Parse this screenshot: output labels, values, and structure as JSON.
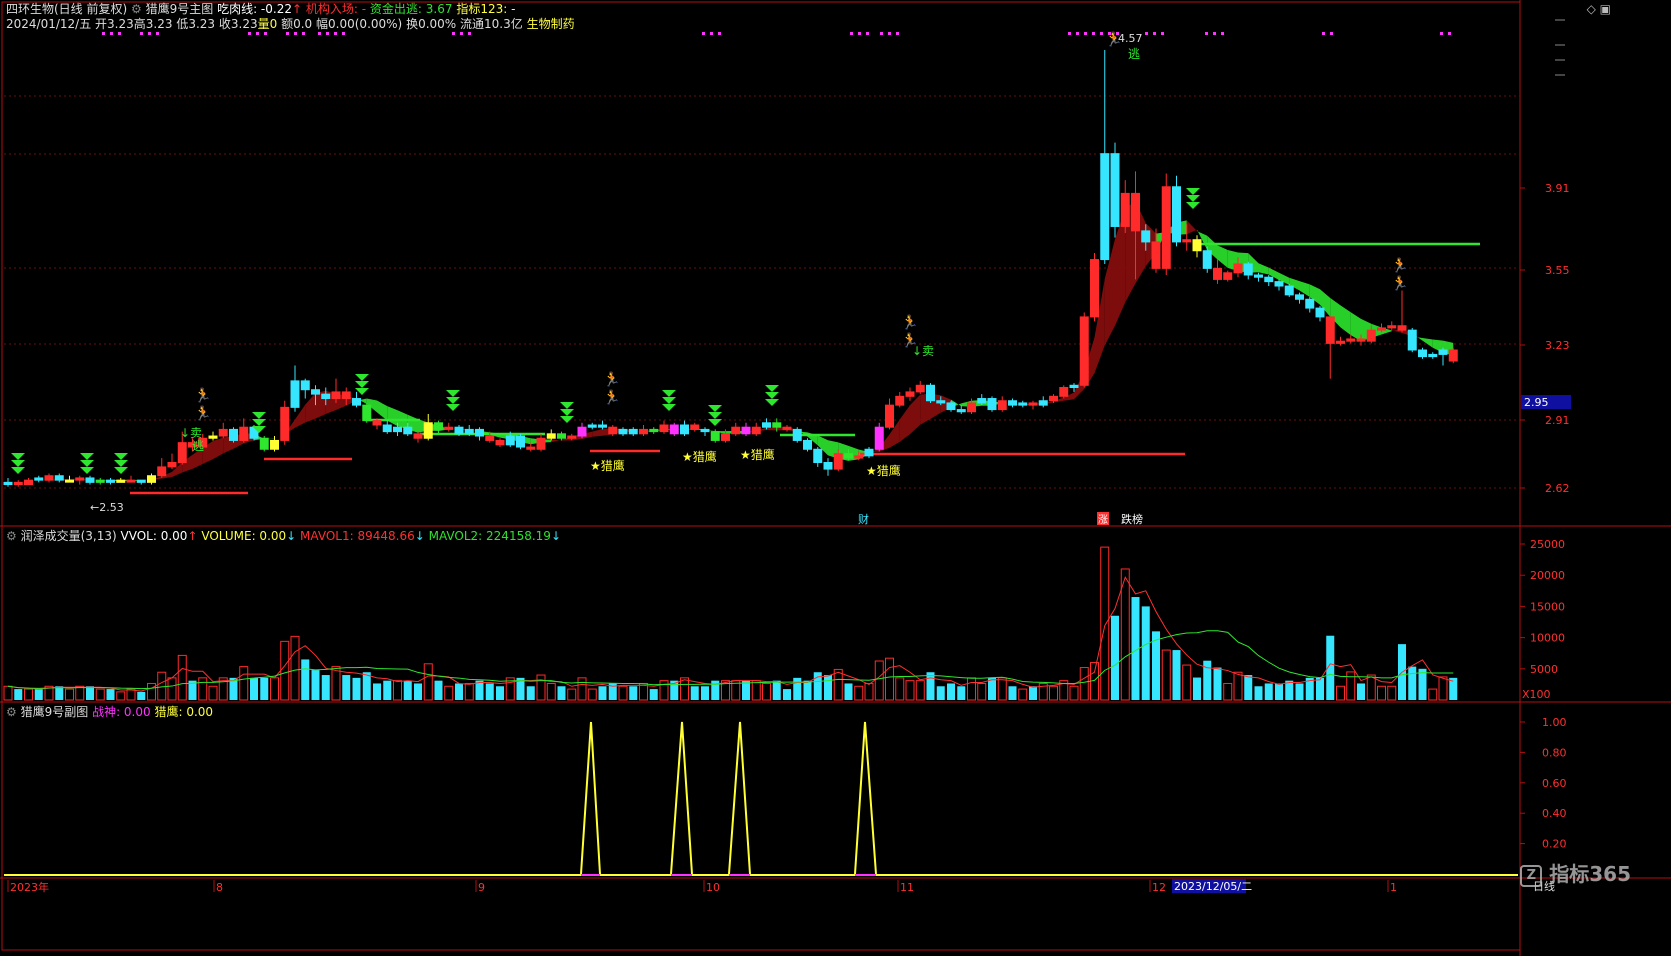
{
  "header": {
    "stock_name": "四环生物(日线 前复权)",
    "formula_name": "猎鹰9号主图",
    "eat_meat_label": "吃肉线: -0.22",
    "institution_label": "机构入场: -",
    "fund_out_label": "资金出逃: 3.67",
    "index_label": "指标123: -"
  },
  "quote": {
    "date": "2024/01/12/五",
    "open": "开3.23",
    "high": "高3.23",
    "low": "低3.23",
    "close": "收3.23",
    "vol": "量0",
    "amount": "额0.0",
    "change": "幅0.00(0.00%)",
    "turnover": "换0.00%",
    "float": "流通10.3亿",
    "sector": "生物制药"
  },
  "volume_panel": {
    "title": "润泽成交量(3,13)",
    "vvol": "VVOL: 0.00",
    "volume": "VOLUME: 0.00",
    "mavol1": "MAVOL1: 89448.66",
    "mavol2": "MAVOL2: 224158.19",
    "axis_labels": [
      "25000",
      "20000",
      "15000",
      "10000",
      "5000"
    ],
    "unit": "X100"
  },
  "sub_panel": {
    "title": "猎鹰9号副图",
    "zhanshen": "战神: 0.00",
    "lieying": "猎鹰: 0.00",
    "axis_labels": [
      "1.00",
      "0.80",
      "0.60",
      "0.40",
      "0.20"
    ]
  },
  "price_axis": {
    "labels": [
      "3.91",
      "3.55",
      "3.23",
      "2.91",
      "2.62"
    ],
    "current_price": "2.95"
  },
  "annotations": {
    "low_price": "2.53",
    "high_price": "4.57",
    "sell": "卖",
    "escape": "逃",
    "lieying_star": "★猎鹰",
    "cai": "财",
    "zhang": "涨",
    "dieban": "跌榜"
  },
  "time_axis": {
    "labels": [
      "2023年",
      "8",
      "9",
      "10",
      "11",
      "12",
      "1"
    ],
    "highlight": "2023/12/05/二",
    "period": "日线"
  },
  "watermark": "指标365",
  "colors": {
    "up": "#ff2a2a",
    "down": "#36e6ff",
    "ma_green": "#2ee62e",
    "ma_red": "#8b0d0d",
    "yellow": "#ffff33",
    "magenta": "#ff33ff"
  },
  "chart_data": {
    "type": "candlestick",
    "candles": [
      [
        2.6,
        2.61,
        2.63,
        2.59,
        "d"
      ],
      [
        2.61,
        2.6,
        2.62,
        2.59,
        "u"
      ],
      [
        2.6,
        2.62,
        2.63,
        2.6,
        "u"
      ],
      [
        2.63,
        2.62,
        2.64,
        2.61,
        "d"
      ],
      [
        2.62,
        2.64,
        2.65,
        2.61,
        "u"
      ],
      [
        2.64,
        2.62,
        2.65,
        2.61,
        "d"
      ],
      [
        2.62,
        2.62,
        2.64,
        2.61,
        "y"
      ],
      [
        2.62,
        2.63,
        2.64,
        2.6,
        "u"
      ],
      [
        2.63,
        2.61,
        2.64,
        2.6,
        "d"
      ],
      [
        2.61,
        2.62,
        2.63,
        2.6,
        "g"
      ],
      [
        2.62,
        2.61,
        2.63,
        2.6,
        "d"
      ],
      [
        2.61,
        2.62,
        2.63,
        2.61,
        "y"
      ],
      [
        2.62,
        2.62,
        2.64,
        2.61,
        "u"
      ],
      [
        2.62,
        2.61,
        2.62,
        2.6,
        "d"
      ],
      [
        2.61,
        2.64,
        2.65,
        2.6,
        "y"
      ],
      [
        2.64,
        2.68,
        2.72,
        2.63,
        "u"
      ],
      [
        2.68,
        2.7,
        2.74,
        2.67,
        "u"
      ],
      [
        2.7,
        2.79,
        2.84,
        2.69,
        "u"
      ],
      [
        2.79,
        2.77,
        2.81,
        2.75,
        "u"
      ],
      [
        2.77,
        2.81,
        2.83,
        2.76,
        "u"
      ],
      [
        2.81,
        2.82,
        2.84,
        2.8,
        "y"
      ],
      [
        2.82,
        2.85,
        2.88,
        2.81,
        "u"
      ],
      [
        2.85,
        2.8,
        2.86,
        2.79,
        "d"
      ],
      [
        2.8,
        2.86,
        2.9,
        2.79,
        "u"
      ],
      [
        2.86,
        2.81,
        2.87,
        2.8,
        "d"
      ],
      [
        2.81,
        2.76,
        2.82,
        2.75,
        "g"
      ],
      [
        2.76,
        2.8,
        2.82,
        2.75,
        "y"
      ],
      [
        2.8,
        2.95,
        2.98,
        2.78,
        "u"
      ],
      [
        2.95,
        3.07,
        3.14,
        2.93,
        "d"
      ],
      [
        3.07,
        3.03,
        3.08,
        2.99,
        "d"
      ],
      [
        3.03,
        3.01,
        3.05,
        2.96,
        "d"
      ],
      [
        3.01,
        2.99,
        3.04,
        2.96,
        "d"
      ],
      [
        2.99,
        3.02,
        3.08,
        2.97,
        "u"
      ],
      [
        3.02,
        2.99,
        3.04,
        2.96,
        "u"
      ],
      [
        2.99,
        2.96,
        3.02,
        2.95,
        "d"
      ],
      [
        2.96,
        2.89,
        2.97,
        2.88,
        "g"
      ],
      [
        2.89,
        2.87,
        2.9,
        2.85,
        "u"
      ],
      [
        2.87,
        2.84,
        2.89,
        2.83,
        "d"
      ],
      [
        2.84,
        2.86,
        2.88,
        2.82,
        "d"
      ],
      [
        2.86,
        2.83,
        2.88,
        2.82,
        "d"
      ],
      [
        2.83,
        2.81,
        2.84,
        2.79,
        "u"
      ],
      [
        2.81,
        2.88,
        2.92,
        2.8,
        "y"
      ],
      [
        2.88,
        2.85,
        2.89,
        2.83,
        "g"
      ],
      [
        2.85,
        2.86,
        2.88,
        2.84,
        "u"
      ],
      [
        2.86,
        2.83,
        2.87,
        2.82,
        "d"
      ],
      [
        2.83,
        2.85,
        2.87,
        2.82,
        "d"
      ],
      [
        2.85,
        2.82,
        2.86,
        2.8,
        "d"
      ],
      [
        2.82,
        2.8,
        2.84,
        2.79,
        "u"
      ],
      [
        2.8,
        2.78,
        2.81,
        2.77,
        "u"
      ],
      [
        2.78,
        2.82,
        2.84,
        2.77,
        "d"
      ],
      [
        2.82,
        2.77,
        2.83,
        2.76,
        "d"
      ],
      [
        2.77,
        2.76,
        2.79,
        2.75,
        "u"
      ],
      [
        2.76,
        2.81,
        2.83,
        2.75,
        "u"
      ],
      [
        2.81,
        2.83,
        2.85,
        2.8,
        "y"
      ],
      [
        2.83,
        2.81,
        2.84,
        2.8,
        "g"
      ],
      [
        2.81,
        2.82,
        2.83,
        2.8,
        "u"
      ],
      [
        2.82,
        2.86,
        2.88,
        2.81,
        "m"
      ],
      [
        2.86,
        2.87,
        2.88,
        2.85,
        "d"
      ],
      [
        2.87,
        2.86,
        2.89,
        2.85,
        "d"
      ],
      [
        2.86,
        2.83,
        2.87,
        2.82,
        "u"
      ],
      [
        2.83,
        2.85,
        2.86,
        2.82,
        "d"
      ],
      [
        2.85,
        2.83,
        2.86,
        2.82,
        "d"
      ],
      [
        2.83,
        2.85,
        2.87,
        2.82,
        "u"
      ],
      [
        2.85,
        2.84,
        2.86,
        2.83,
        "g"
      ],
      [
        2.84,
        2.87,
        2.89,
        2.83,
        "u"
      ],
      [
        2.87,
        2.83,
        2.88,
        2.82,
        "m"
      ],
      [
        2.83,
        2.87,
        2.89,
        2.82,
        "d"
      ],
      [
        2.87,
        2.85,
        2.88,
        2.84,
        "u"
      ],
      [
        2.85,
        2.84,
        2.86,
        2.82,
        "d"
      ],
      [
        2.84,
        2.8,
        2.85,
        2.79,
        "g"
      ],
      [
        2.8,
        2.83,
        2.85,
        2.79,
        "u"
      ],
      [
        2.83,
        2.86,
        2.88,
        2.82,
        "u"
      ],
      [
        2.86,
        2.83,
        2.88,
        2.82,
        "m"
      ],
      [
        2.83,
        2.86,
        2.88,
        2.82,
        "u"
      ],
      [
        2.86,
        2.88,
        2.9,
        2.85,
        "d"
      ],
      [
        2.88,
        2.86,
        2.9,
        2.84,
        "g"
      ],
      [
        2.86,
        2.85,
        2.87,
        2.84,
        "u"
      ],
      [
        2.85,
        2.8,
        2.86,
        2.79,
        "d"
      ],
      [
        2.8,
        2.76,
        2.81,
        2.75,
        "d"
      ],
      [
        2.76,
        2.7,
        2.77,
        2.68,
        "d"
      ],
      [
        2.7,
        2.67,
        2.72,
        2.64,
        "d"
      ],
      [
        2.67,
        2.74,
        2.76,
        2.66,
        "u"
      ],
      [
        2.74,
        2.72,
        2.76,
        2.71,
        "g"
      ],
      [
        2.72,
        2.73,
        2.75,
        2.71,
        "u"
      ],
      [
        2.73,
        2.76,
        2.77,
        2.72,
        "d"
      ],
      [
        2.76,
        2.86,
        2.88,
        2.75,
        "m"
      ],
      [
        2.86,
        2.96,
        2.99,
        2.85,
        "u"
      ],
      [
        2.96,
        3.0,
        3.02,
        2.95,
        "u"
      ],
      [
        3.0,
        3.02,
        3.04,
        2.98,
        "u"
      ],
      [
        3.02,
        3.05,
        3.07,
        3.01,
        "u"
      ],
      [
        3.05,
        2.98,
        3.06,
        2.97,
        "d"
      ],
      [
        2.98,
        2.97,
        3.0,
        2.96,
        "d"
      ],
      [
        2.97,
        2.94,
        2.98,
        2.93,
        "d"
      ],
      [
        2.94,
        2.93,
        2.96,
        2.92,
        "d"
      ],
      [
        2.93,
        2.97,
        2.99,
        2.92,
        "u"
      ],
      [
        2.97,
        2.99,
        3.01,
        2.96,
        "d"
      ],
      [
        2.99,
        2.94,
        3.0,
        2.93,
        "d"
      ],
      [
        2.94,
        2.98,
        3.0,
        2.93,
        "u"
      ],
      [
        2.98,
        2.96,
        2.99,
        2.95,
        "d"
      ],
      [
        2.96,
        2.97,
        2.98,
        2.95,
        "d"
      ],
      [
        2.97,
        2.96,
        2.98,
        2.94,
        "u"
      ],
      [
        2.96,
        2.98,
        3.0,
        2.95,
        "d"
      ],
      [
        2.98,
        3.0,
        3.01,
        2.97,
        "u"
      ],
      [
        3.0,
        3.04,
        3.05,
        2.99,
        "u"
      ],
      [
        3.04,
        3.05,
        3.06,
        3.02,
        "d"
      ],
      [
        3.05,
        3.36,
        3.38,
        3.04,
        "u"
      ],
      [
        3.36,
        3.62,
        3.65,
        3.34,
        "u"
      ],
      [
        3.62,
        4.1,
        4.57,
        3.6,
        "d"
      ],
      [
        4.1,
        3.77,
        4.15,
        3.72,
        "d"
      ],
      [
        3.77,
        3.92,
        3.98,
        3.74,
        "u"
      ],
      [
        3.92,
        3.75,
        4.02,
        3.53,
        "u"
      ],
      [
        3.75,
        3.7,
        3.78,
        3.66,
        "d"
      ],
      [
        3.7,
        3.58,
        3.76,
        3.56,
        "u"
      ],
      [
        3.58,
        3.95,
        4.01,
        3.55,
        "u"
      ],
      [
        3.95,
        3.7,
        4.0,
        3.68,
        "d"
      ],
      [
        3.7,
        3.71,
        3.78,
        3.66,
        "u"
      ],
      [
        3.71,
        3.66,
        3.73,
        3.63,
        "y"
      ],
      [
        3.66,
        3.58,
        3.68,
        3.56,
        "d"
      ],
      [
        3.58,
        3.53,
        3.62,
        3.51,
        "u"
      ],
      [
        3.53,
        3.56,
        3.57,
        3.52,
        "u"
      ],
      [
        3.56,
        3.6,
        3.63,
        3.54,
        "u"
      ],
      [
        3.6,
        3.55,
        3.61,
        3.53,
        "d"
      ],
      [
        3.55,
        3.54,
        3.56,
        3.52,
        "d"
      ],
      [
        3.54,
        3.52,
        3.55,
        3.5,
        "d"
      ],
      [
        3.52,
        3.5,
        3.53,
        3.48,
        "d"
      ],
      [
        3.5,
        3.46,
        3.51,
        3.45,
        "d"
      ],
      [
        3.46,
        3.44,
        3.47,
        3.42,
        "d"
      ],
      [
        3.44,
        3.4,
        3.45,
        3.38,
        "d"
      ],
      [
        3.4,
        3.36,
        3.41,
        3.34,
        "d"
      ],
      [
        3.36,
        3.24,
        3.3,
        3.08,
        "u"
      ],
      [
        3.24,
        3.25,
        3.27,
        3.23,
        "u"
      ],
      [
        3.25,
        3.26,
        3.28,
        3.24,
        "u"
      ],
      [
        3.26,
        3.25,
        3.28,
        3.23,
        "u"
      ],
      [
        3.25,
        3.3,
        3.32,
        3.24,
        "u"
      ],
      [
        3.3,
        3.31,
        3.33,
        3.29,
        "u"
      ],
      [
        3.31,
        3.32,
        3.34,
        3.3,
        "u"
      ],
      [
        3.32,
        3.3,
        3.48,
        3.29,
        "u"
      ],
      [
        3.3,
        3.21,
        3.31,
        3.2,
        "d"
      ],
      [
        3.21,
        3.18,
        3.22,
        3.17,
        "d"
      ],
      [
        3.18,
        3.19,
        3.2,
        3.17,
        "d"
      ],
      [
        3.19,
        3.21,
        3.22,
        3.14,
        "d"
      ],
      [
        3.21,
        3.16,
        3.22,
        3.15,
        "u"
      ]
    ]
  }
}
